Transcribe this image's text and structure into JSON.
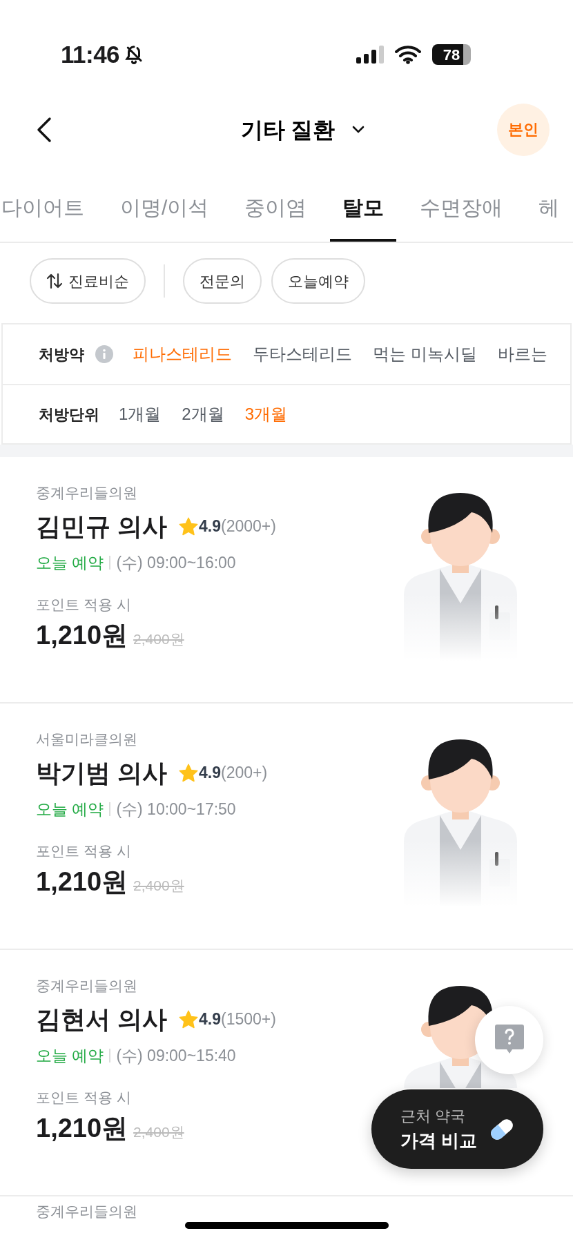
{
  "status_bar": {
    "time": "11:46",
    "battery": "78"
  },
  "header": {
    "title": "기타 질환",
    "profile_badge": "본인"
  },
  "tabs": [
    {
      "label": "다이어트",
      "selected": false
    },
    {
      "label": "이명/이석",
      "selected": false
    },
    {
      "label": "중이염",
      "selected": false
    },
    {
      "label": "탈모",
      "selected": true
    },
    {
      "label": "수면장애",
      "selected": false
    },
    {
      "label": "헤",
      "selected": false
    }
  ],
  "filters": [
    {
      "label": "진료비순",
      "kind": "sort"
    },
    {
      "label": "전문의",
      "kind": "chip"
    },
    {
      "label": "오늘예약",
      "kind": "chip"
    }
  ],
  "prescription": [
    {
      "label": "처방약",
      "info": true,
      "options": [
        {
          "label": "피나스테리드",
          "selected": true
        },
        {
          "label": "두타스테리드",
          "selected": false
        },
        {
          "label": "먹는 미녹시딜",
          "selected": false
        },
        {
          "label": "바르는",
          "selected": false
        }
      ]
    },
    {
      "label": "처방단위",
      "info": false,
      "options": [
        {
          "label": "1개월",
          "selected": false
        },
        {
          "label": "2개월",
          "selected": false
        },
        {
          "label": "3개월",
          "selected": true
        }
      ]
    }
  ],
  "doctors": [
    {
      "clinic": "중계우리들의원",
      "name": "김민규 의사",
      "rating": "4.9",
      "reviews": "(2000+)",
      "booking": "오늘 예약",
      "hours": "(수) 09:00~16:00",
      "point_label": "포인트 적용 시",
      "price": "1,210원",
      "original_price": "2,400원"
    },
    {
      "clinic": "서울미라클의원",
      "name": "박기범 의사",
      "rating": "4.9",
      "reviews": "(200+)",
      "booking": "오늘 예약",
      "hours": "(수) 10:00~17:50",
      "point_label": "포인트 적용 시",
      "price": "1,210원",
      "original_price": "2,400원"
    },
    {
      "clinic": "중계우리들의원",
      "name": "김현서 의사",
      "rating": "4.9",
      "reviews": "(1500+)",
      "booking": "오늘 예약",
      "hours": "(수) 09:00~15:40",
      "point_label": "포인트 적용 시",
      "price": "1,210원",
      "original_price": "2,400원"
    }
  ],
  "next_clinic": "중계우리들의원",
  "pharmacy_button": {
    "line1": "근처 약국",
    "line2": "가격 비교"
  }
}
